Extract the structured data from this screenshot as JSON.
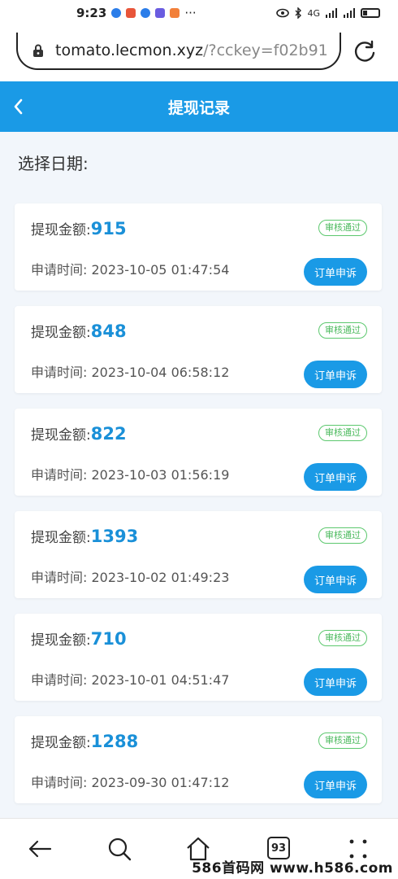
{
  "status_bar": {
    "time": "9:23",
    "more": "···",
    "network": "4G"
  },
  "browser": {
    "url_host": "tomato.lecmon.xyz",
    "url_query": "/?cckey=f02b91",
    "tab_count": "93"
  },
  "header": {
    "title": "提现记录"
  },
  "filter": {
    "date_label": "选择日期:"
  },
  "records": [
    {
      "amount_label": "提现金额:",
      "amount": "915",
      "status": "审核通过",
      "time_label": "申请时间:",
      "time": "2023-10-05 01:47:54",
      "action": "订单申诉"
    },
    {
      "amount_label": "提现金额:",
      "amount": "848",
      "status": "审核通过",
      "time_label": "申请时间:",
      "time": "2023-10-04 06:58:12",
      "action": "订单申诉"
    },
    {
      "amount_label": "提现金额:",
      "amount": "822",
      "status": "审核通过",
      "time_label": "申请时间:",
      "time": "2023-10-03 01:56:19",
      "action": "订单申诉"
    },
    {
      "amount_label": "提现金额:",
      "amount": "1393",
      "status": "审核通过",
      "time_label": "申请时间:",
      "time": "2023-10-02 01:49:23",
      "action": "订单申诉"
    },
    {
      "amount_label": "提现金额:",
      "amount": "710",
      "status": "审核通过",
      "time_label": "申请时间:",
      "time": "2023-10-01 04:51:47",
      "action": "订单申诉"
    },
    {
      "amount_label": "提现金额:",
      "amount": "1288",
      "status": "审核通过",
      "time_label": "申请时间:",
      "time": "2023-09-30 01:47:12",
      "action": "订单申诉"
    }
  ],
  "watermark": "586首码网 www.h586.com",
  "colors": {
    "accent": "#1a9ae6",
    "amount": "#1a90d8",
    "approved": "#4cba5e"
  },
  "icons": {
    "back": "back-icon",
    "lock": "lock-icon",
    "reload": "reload-icon",
    "nav_back": "arrow-left-icon",
    "nav_search": "search-icon",
    "nav_home": "home-icon",
    "nav_menu": "more-dots-icon"
  }
}
